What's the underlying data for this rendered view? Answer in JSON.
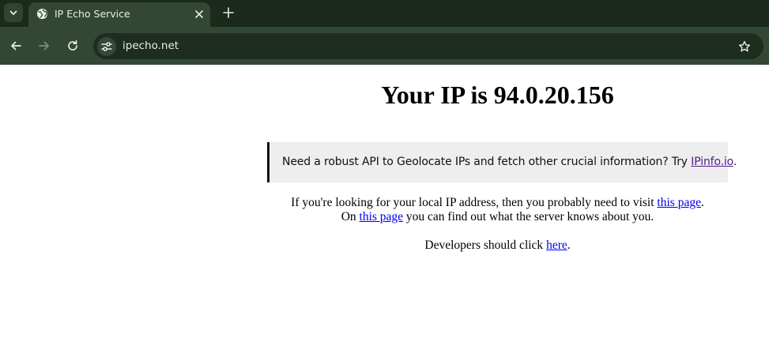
{
  "browser": {
    "tab": {
      "title": "IP Echo Service"
    },
    "address_bar": {
      "url": "ipecho.net"
    },
    "colors": {
      "frame": "#1b2a1c",
      "toolbar": "#334834",
      "omnibox": "#1e2d1f",
      "icon": "#e8eee7"
    }
  },
  "page": {
    "headline": "Your IP is 94.0.20.156",
    "promo": {
      "text": "Need a robust API to Geolocate IPs and fetch other crucial information? Try ",
      "link": "IPinfo.io",
      "suffix": "."
    },
    "lines": [
      {
        "before": "If you're looking for your local IP address, then you probably need to visit ",
        "link": "this page",
        "after": "."
      },
      {
        "before": "On ",
        "link": "this page",
        "after": " you can find out what the server knows about you."
      },
      {
        "before": "Developers should click ",
        "link": "here",
        "after": "."
      }
    ],
    "colors": {
      "link": "#0000ee",
      "visited_link": "#551a8b",
      "promo_bg": "#eeeeee"
    }
  }
}
